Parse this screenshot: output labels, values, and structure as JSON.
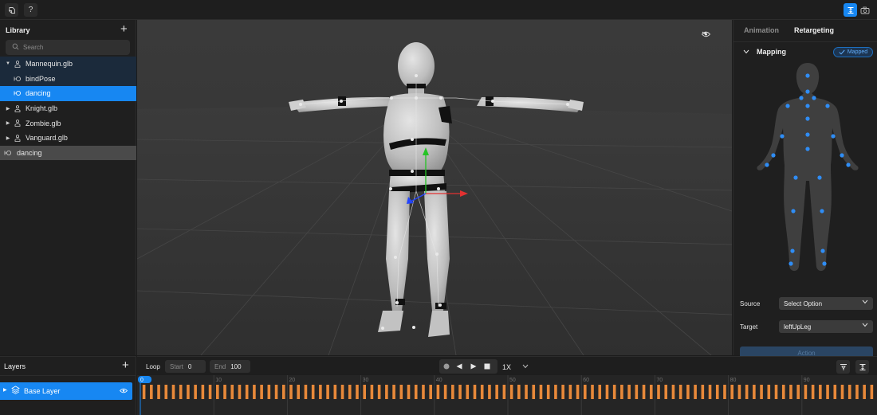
{
  "topbar": {
    "left_buttons": [
      {
        "icon": "palette-icon"
      },
      {
        "icon": "help-icon",
        "label": "?"
      }
    ],
    "right_buttons": [
      {
        "icon": "fit-view-icon",
        "active": true
      },
      {
        "icon": "camera-icon",
        "active": false
      }
    ]
  },
  "library": {
    "title": "Library",
    "search_placeholder": "Search",
    "items": [
      {
        "label": "Mannequin.glb",
        "type": "model",
        "expanded": true,
        "depth": 0
      },
      {
        "label": "bindPose",
        "type": "animation",
        "depth": 1
      },
      {
        "label": "dancing",
        "type": "animation",
        "depth": 1,
        "selected": true
      },
      {
        "label": "Knight.glb",
        "type": "model",
        "expanded": false,
        "depth": 0
      },
      {
        "label": "Zombie.glb",
        "type": "model",
        "expanded": false,
        "depth": 0
      },
      {
        "label": "Vanguard.glb",
        "type": "model",
        "expanded": false,
        "depth": 0
      },
      {
        "label": "dancing",
        "type": "animation",
        "depth": -1
      }
    ]
  },
  "viewport": {
    "view_toggle_icon": "eye-icon"
  },
  "right_panel": {
    "tabs": [
      {
        "label": "Animation",
        "active": false
      },
      {
        "label": "Retargeting",
        "active": true
      }
    ],
    "mapping": {
      "title": "Mapping",
      "badge": "Mapped"
    },
    "source_label": "Source",
    "source_value": "Select Option",
    "target_label": "Target",
    "target_value": "leftUpLeg",
    "action_label": "Action"
  },
  "layers": {
    "title": "Layers",
    "items": [
      {
        "label": "Base Layer",
        "visible": true
      }
    ]
  },
  "timeline": {
    "loop_label": "Loop",
    "start_label": "Start",
    "start_value": "0",
    "end_label": "End",
    "end_value": "100",
    "speed": "1X",
    "current_frame": "0",
    "ruler_labels": [
      "10",
      "20",
      "30",
      "40",
      "50",
      "60",
      "70",
      "80",
      "90"
    ],
    "keyframe_count": 100
  },
  "colors": {
    "accent": "#1787f2",
    "keyframe": "#e8893a",
    "joint": "#2f8df5",
    "background": "#1b1b1b"
  }
}
